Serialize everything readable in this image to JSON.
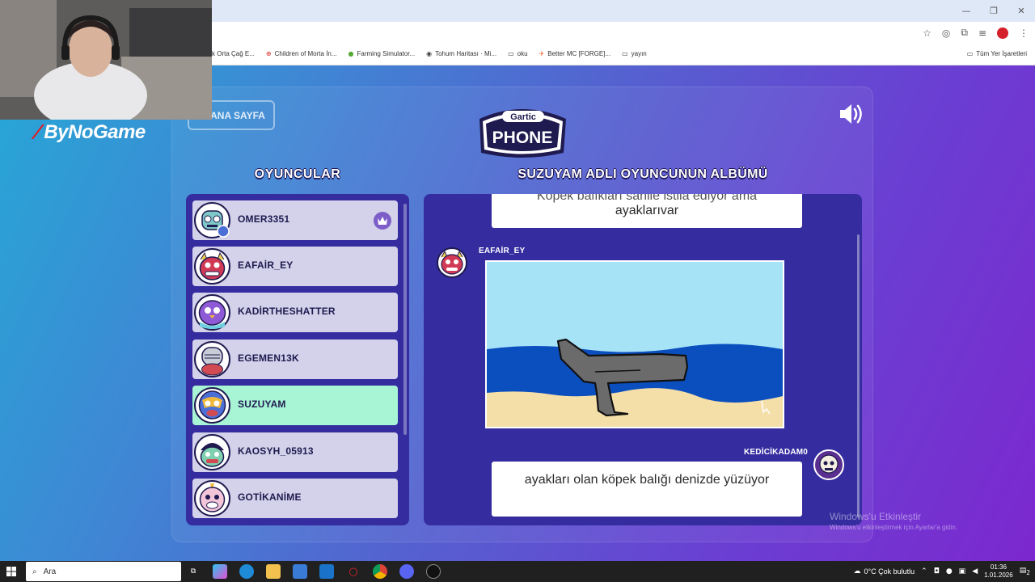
{
  "browser": {
    "bookmarks": [
      {
        "label": "k Orta Çağ E...",
        "icon": "site-icon"
      },
      {
        "label": "Children of Morta İn...",
        "icon": "gamepad-icon"
      },
      {
        "label": "Farming Simulator...",
        "icon": "site-icon"
      },
      {
        "label": "Tohum Haritası · Mi...",
        "icon": "site-icon"
      },
      {
        "label": "oku",
        "icon": "folder-icon"
      },
      {
        "label": "Better MC [FORGE]...",
        "icon": "site-icon"
      },
      {
        "label": "yayın",
        "icon": "folder-icon"
      }
    ],
    "all_bookmarks_label": "Tüm Yer İşaretleri"
  },
  "stream": {
    "brand": "ByNoGame"
  },
  "game": {
    "home_button": "ANA SAYFA",
    "logo_top": "Gartic",
    "logo_bottom": "PHONE",
    "players_heading": "OYUNCULAR",
    "album_heading": "SUZUYAM ADLI OYUNCUNUN ALBÜMÜ",
    "players": [
      {
        "name": "OMER3351",
        "host": true,
        "active": false,
        "avatar_color": "#7ec8c8"
      },
      {
        "name": "EAFAİR_EY",
        "host": false,
        "active": false,
        "avatar_color": "#d13a55"
      },
      {
        "name": "KADİRTHESHATTER",
        "host": false,
        "active": false,
        "avatar_color": "#8e5ad6"
      },
      {
        "name": "EGEMEN13K",
        "host": false,
        "active": false,
        "avatar_color": "#d34b52"
      },
      {
        "name": "SUZUYAM",
        "host": false,
        "active": true,
        "avatar_color": "#f0b93a"
      },
      {
        "name": "KAOSYH_05913",
        "host": false,
        "active": false,
        "avatar_color": "#2c9a6a"
      },
      {
        "name": "GOTİKANİME",
        "host": false,
        "active": false,
        "avatar_color": "#f2c6d8"
      }
    ],
    "album": {
      "first_text_line1": "Köpek balıkları sahile istila ediyor ama",
      "first_text_line2": "ayaklarıvar",
      "drawing_author": "EAFAİR_EY",
      "second_author": "KEDİCİKADAM0",
      "second_text": "ayakları olan köpek balığı denizde yüzüyor"
    }
  },
  "windows_watermark": {
    "title": "Windows'u Etkinleştir",
    "subtitle": "Windows'u etkinleştirmek için Ayarlar'a gidin."
  },
  "taskbar": {
    "search_placeholder": "Ara",
    "weather": "0°C  Çok bulutlu",
    "time": "01:36",
    "date": "1.01.2026",
    "notification_count": "2"
  }
}
